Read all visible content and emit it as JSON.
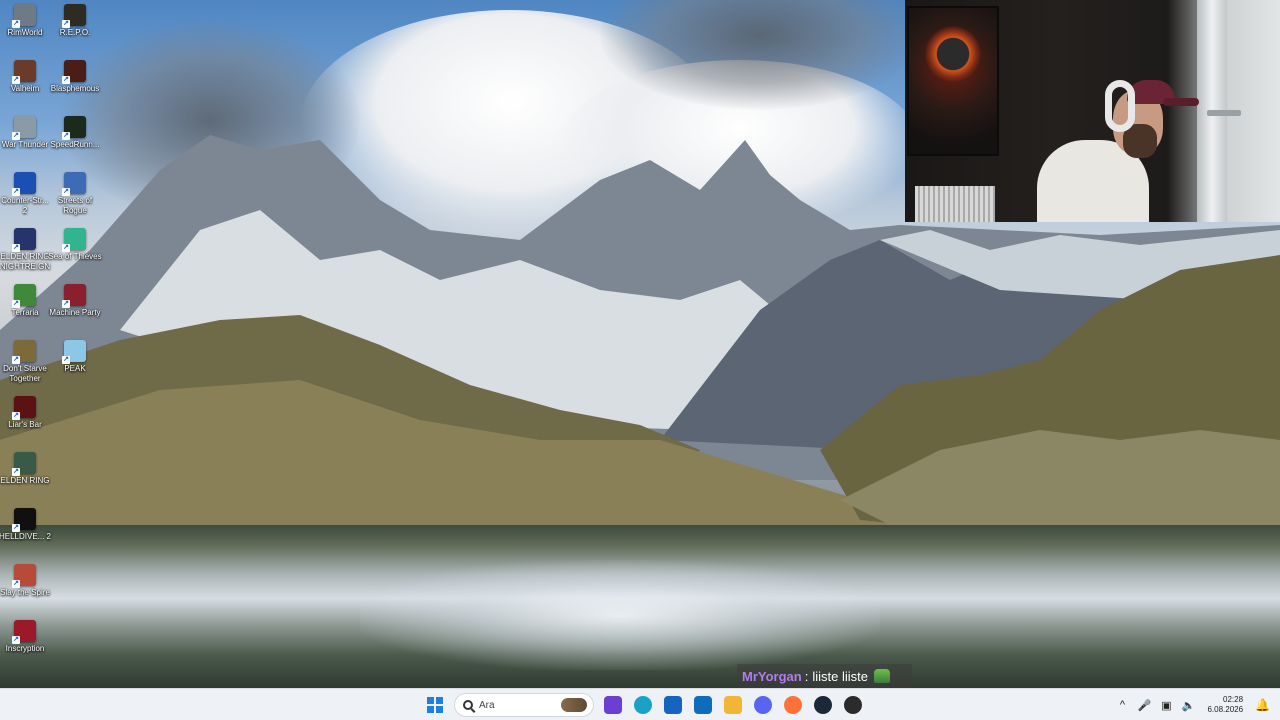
{
  "desktop": {
    "icons": [
      {
        "label": "RimWorld",
        "icon": "rimworld-icon",
        "color": "#6e7b86"
      },
      {
        "label": "R.E.P.O.",
        "icon": "repo-icon",
        "color": "#2f2a22"
      },
      {
        "label": "Valheim",
        "icon": "valheim-icon",
        "color": "#6a3a2a"
      },
      {
        "label": "Blasphemous",
        "icon": "blasphemous-icon",
        "color": "#4a1e16"
      },
      {
        "label": "War Thunder",
        "icon": "war-thunder-icon",
        "color": "#8a9aa6"
      },
      {
        "label": "SpeedRunn...",
        "icon": "speedrunners-icon",
        "color": "#1c2a1c"
      },
      {
        "label": "Counter-Str... 2",
        "icon": "counter-strike-icon",
        "color": "#1c4fb2"
      },
      {
        "label": "Streets of Rogue",
        "icon": "streets-of-rogue-icon",
        "color": "#3d6bb6"
      },
      {
        "label": "ELDEN RING NIGHTREIGN",
        "icon": "elden-ring-nightreign-icon",
        "color": "#27346b"
      },
      {
        "label": "Sea of Thieves",
        "icon": "sea-of-thieves-icon",
        "color": "#31b58e"
      },
      {
        "label": "Terraria",
        "icon": "terraria-icon",
        "color": "#3f8a3a"
      },
      {
        "label": "Machine Party",
        "icon": "machine-party-icon",
        "color": "#8b1f2e"
      },
      {
        "label": "Don't Starve Together",
        "icon": "dont-starve-together-icon",
        "color": "#7c6a3a"
      },
      {
        "label": "PEAK",
        "icon": "peak-icon",
        "color": "#8cc7e8"
      },
      {
        "label": "Liar's Bar",
        "icon": "liars-bar-icon",
        "color": "#5a1212"
      },
      {
        "label": "ELDEN RING",
        "icon": "elden-ring-icon",
        "color": "#3a5a48"
      },
      {
        "label": "HELLDIVE... 2",
        "icon": "helldivers-2-icon",
        "color": "#101010"
      },
      {
        "label": "Slay the Spire",
        "icon": "slay-the-spire-icon",
        "color": "#b84a3a"
      },
      {
        "label": "Inscryption",
        "icon": "inscryption-icon",
        "color": "#9b1a2a"
      }
    ]
  },
  "chat": {
    "username": "MrYorgan",
    "separator": ":",
    "message": "liiste liiste",
    "user_color": "#b37bf0"
  },
  "taskbar": {
    "search_placeholder": "Ara",
    "apps": [
      {
        "name": "start-button",
        "icon": "windows-logo-icon",
        "color": "#1f7fe0"
      },
      {
        "name": "store-app",
        "icon": "microsoft-store-icon",
        "color": "#6b3fd1"
      },
      {
        "name": "edge-app",
        "icon": "edge-icon",
        "color": "#1ba1c7"
      },
      {
        "name": "calendar-app",
        "icon": "calendar-icon",
        "color": "#1565c0"
      },
      {
        "name": "outlook-app",
        "icon": "outlook-icon",
        "color": "#0f6cbd"
      },
      {
        "name": "file-explorer-app",
        "icon": "folder-icon",
        "color": "#f2b636"
      },
      {
        "name": "discord-app",
        "icon": "discord-icon",
        "color": "#5865f2"
      },
      {
        "name": "firefox-app",
        "icon": "firefox-icon",
        "color": "#ff7139"
      },
      {
        "name": "steam-app",
        "icon": "steam-icon",
        "color": "#1b2838"
      },
      {
        "name": "obs-app",
        "icon": "obs-icon",
        "color": "#2b2b2b"
      }
    ],
    "tray": {
      "chevron": "^",
      "time": "02:28",
      "date": "6.08.2026"
    }
  }
}
